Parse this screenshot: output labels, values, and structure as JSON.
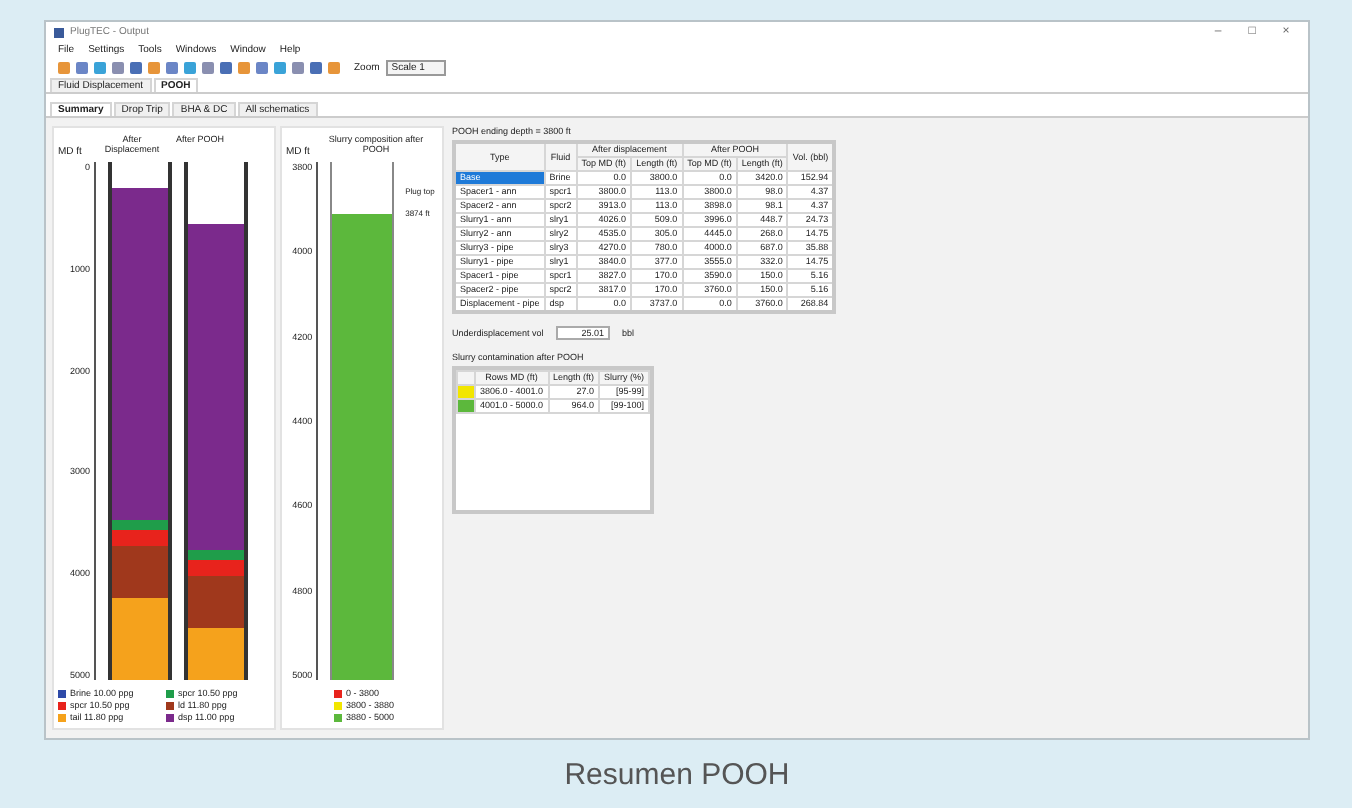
{
  "window": {
    "title": "PlugTEC - Output",
    "controls": [
      "–",
      "□",
      "×"
    ]
  },
  "menu": [
    "File",
    "Settings",
    "Tools",
    "Windows",
    "Window",
    "Help"
  ],
  "toolbar": {
    "zoom_label": "Zoom",
    "zoom_value": "Scale 1"
  },
  "tabs": [
    {
      "label": "Fluid Displacement",
      "selected": false
    },
    {
      "label": "POOH",
      "selected": true
    }
  ],
  "subtabs": [
    {
      "label": "Summary",
      "selected": true
    },
    {
      "label": "Drop Trip",
      "selected": false
    },
    {
      "label": "BHA & DC",
      "selected": false
    },
    {
      "label": "All schematics",
      "selected": false
    }
  ],
  "schematic": {
    "axis_label": "MD ft",
    "ticks": [
      "0",
      "1000",
      "2000",
      "3000",
      "4000",
      "5000"
    ],
    "columns": [
      {
        "title": "After Displacement"
      },
      {
        "title": "After POOH"
      }
    ],
    "legend": [
      {
        "label": "Brine 10.00 ppg",
        "color": "#2e4aa8"
      },
      {
        "label": "spcr 10.50 ppg",
        "color": "#1f9d4a"
      },
      {
        "label": "spcr 10.50 ppg",
        "color": "#e8231c"
      },
      {
        "label": "ld 11.80 ppg",
        "color": "#a0381c"
      },
      {
        "label": "tail 11.80 ppg",
        "color": "#f5a21c"
      },
      {
        "label": "dsp 11.00 ppg",
        "color": "#7b2a8c"
      }
    ]
  },
  "slurry": {
    "title": "Slurry composition after POOH",
    "axis_label": "MD ft",
    "ticks": [
      "3800",
      "4000",
      "4200",
      "4400",
      "4600",
      "4800",
      "5000"
    ],
    "plug_label": "Plug top",
    "depth_label": "3874 ft",
    "legend": [
      {
        "label": "0 - 3800",
        "color": "#e8231c"
      },
      {
        "label": "3800 - 3880",
        "color": "#f2e600"
      },
      {
        "label": "3880 - 5000",
        "color": "#5cb83c"
      }
    ]
  },
  "table": {
    "title": "POOH ending depth = 3800 ft",
    "groups": [
      "After displacement",
      "After POOH"
    ],
    "columns": [
      "Type",
      "Fluid",
      "Top MD (ft)",
      "Length (ft)",
      "Top MD (ft)",
      "Length (ft)",
      "Vol. (bbl)"
    ],
    "rows": [
      {
        "selected": true,
        "cells": [
          "Base",
          "Brine",
          "0.0",
          "3800.0",
          "0.0",
          "3420.0",
          "152.94"
        ]
      },
      {
        "selected": false,
        "cells": [
          "Spacer1 - ann",
          "spcr1",
          "3800.0",
          "113.0",
          "3800.0",
          "98.0",
          "4.37"
        ]
      },
      {
        "selected": false,
        "cells": [
          "Spacer2 - ann",
          "spcr2",
          "3913.0",
          "113.0",
          "3898.0",
          "98.1",
          "4.37"
        ]
      },
      {
        "selected": false,
        "cells": [
          "Slurry1 - ann",
          "slry1",
          "4026.0",
          "509.0",
          "3996.0",
          "448.7",
          "24.73"
        ]
      },
      {
        "selected": false,
        "cells": [
          "Slurry2 - ann",
          "slry2",
          "4535.0",
          "305.0",
          "4445.0",
          "268.0",
          "14.75"
        ]
      },
      {
        "selected": false,
        "cells": [
          "Slurry3 - pipe",
          "slry3",
          "4270.0",
          "780.0",
          "4000.0",
          "687.0",
          "35.88"
        ]
      },
      {
        "selected": false,
        "cells": [
          "Slurry1 - pipe",
          "slry1",
          "3840.0",
          "377.0",
          "3555.0",
          "332.0",
          "14.75"
        ]
      },
      {
        "selected": false,
        "cells": [
          "Spacer1 - pipe",
          "spcr1",
          "3827.0",
          "170.0",
          "3590.0",
          "150.0",
          "5.16"
        ]
      },
      {
        "selected": false,
        "cells": [
          "Spacer2 - pipe",
          "spcr2",
          "3817.0",
          "170.0",
          "3760.0",
          "150.0",
          "5.16"
        ]
      },
      {
        "selected": false,
        "cells": [
          "Displacement - pipe",
          "dsp",
          "0.0",
          "3737.0",
          "0.0",
          "3760.0",
          "268.84"
        ]
      }
    ]
  },
  "underdisp": {
    "label": "Underdisplacement vol",
    "value": "25.01",
    "unit": "bbl"
  },
  "contamination": {
    "title": "Slurry contamination after POOH",
    "columns": [
      "Rows MD (ft)",
      "Length (ft)",
      "Slurry (%)"
    ],
    "rows": [
      {
        "color": "#f2e600",
        "cells": [
          "3806.0 - 4001.0",
          "27.0",
          "[95-99]"
        ]
      },
      {
        "color": "#5cb83c",
        "cells": [
          "4001.0 - 5000.0",
          "964.0",
          "[99-100]"
        ]
      }
    ]
  },
  "caption": "Resumen POOH"
}
